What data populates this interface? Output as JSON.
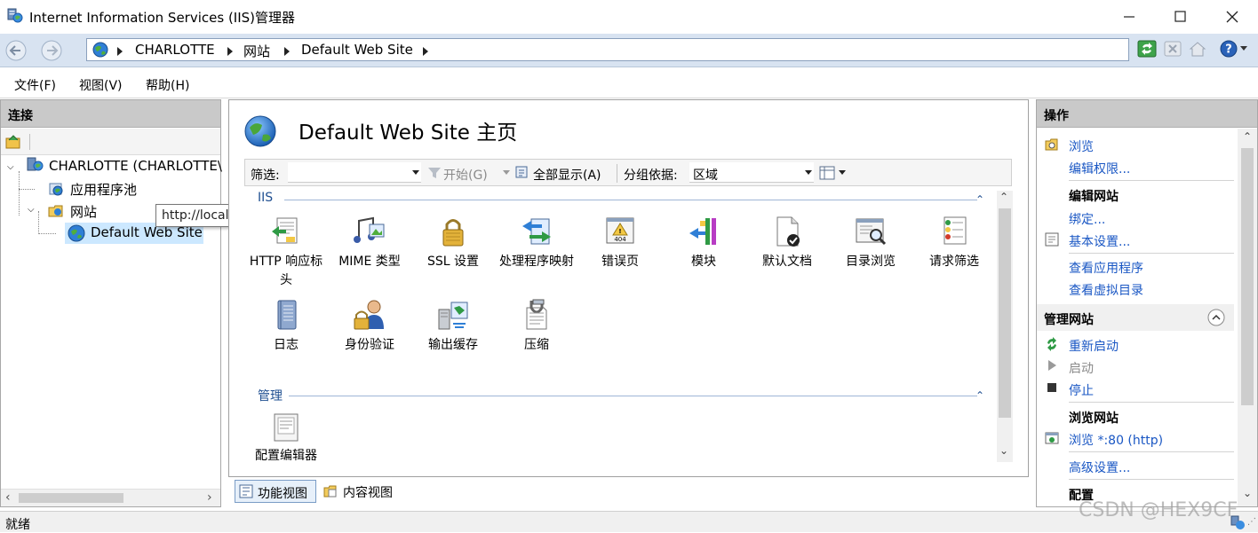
{
  "window": {
    "title": "Internet Information Services (IIS)管理器"
  },
  "address_bar": {
    "crumbs": [
      "CHARLOTTE",
      "网站",
      "Default Web Site"
    ]
  },
  "menu": {
    "items": [
      "文件(F)",
      "视图(V)",
      "帮助(H)"
    ]
  },
  "connections": {
    "header": "连接",
    "tree": {
      "server": "CHARLOTTE (CHARLOTTE\\",
      "app_pools": "应用程序池",
      "sites": "网站",
      "site": "Default Web Site"
    },
    "tooltip": "http://localhost/"
  },
  "center": {
    "title": "Default Web Site 主页",
    "filter_label": "筛选:",
    "start_label": "开始(G)",
    "show_all_label": "全部显示(A)",
    "group_label": "分组依据:",
    "group_value": "区域",
    "section_iis": "IIS",
    "section_manage": "管理",
    "features": [
      {
        "label": "HTTP 响应标头",
        "icon": "http-response-headers-icon"
      },
      {
        "label": "MIME 类型",
        "icon": "mime-types-icon"
      },
      {
        "label": "SSL 设置",
        "icon": "ssl-settings-icon"
      },
      {
        "label": "处理程序映射",
        "icon": "handler-mappings-icon"
      },
      {
        "label": "错误页",
        "icon": "error-pages-icon"
      },
      {
        "label": "模块",
        "icon": "modules-icon"
      },
      {
        "label": "默认文档",
        "icon": "default-document-icon"
      },
      {
        "label": "目录浏览",
        "icon": "directory-browsing-icon"
      },
      {
        "label": "请求筛选",
        "icon": "request-filtering-icon"
      },
      {
        "label": "日志",
        "icon": "logging-icon"
      },
      {
        "label": "身份验证",
        "icon": "authentication-icon"
      },
      {
        "label": "输出缓存",
        "icon": "output-caching-icon"
      },
      {
        "label": "压缩",
        "icon": "compression-icon"
      }
    ],
    "manage_features": [
      {
        "label": "配置编辑器",
        "icon": "configuration-editor-icon"
      }
    ],
    "error_icon_text": "404",
    "tab_features": "功能视图",
    "tab_content": "内容视图"
  },
  "actions": {
    "header": "操作",
    "browse": "浏览",
    "edit_permissions": "编辑权限...",
    "edit_site_head": "编辑网站",
    "bindings": "绑定...",
    "basic_settings": "基本设置...",
    "view_applications": "查看应用程序",
    "view_virtual_dirs": "查看虚拟目录",
    "manage_site_head": "管理网站",
    "restart": "重新启动",
    "start": "启动",
    "stop": "停止",
    "browse_site_head": "浏览网站",
    "browse_80": "浏览 *:80 (http)",
    "advanced_settings": "高级设置...",
    "config_head": "配置"
  },
  "status": {
    "text": "就绪",
    "watermark": "CSDN @HEX9CF"
  },
  "colors": {
    "link": "#1a57c4",
    "selection": "#cce8ff",
    "panel_header": "#c9c9c9",
    "addressbar": "#d8e3f1"
  }
}
